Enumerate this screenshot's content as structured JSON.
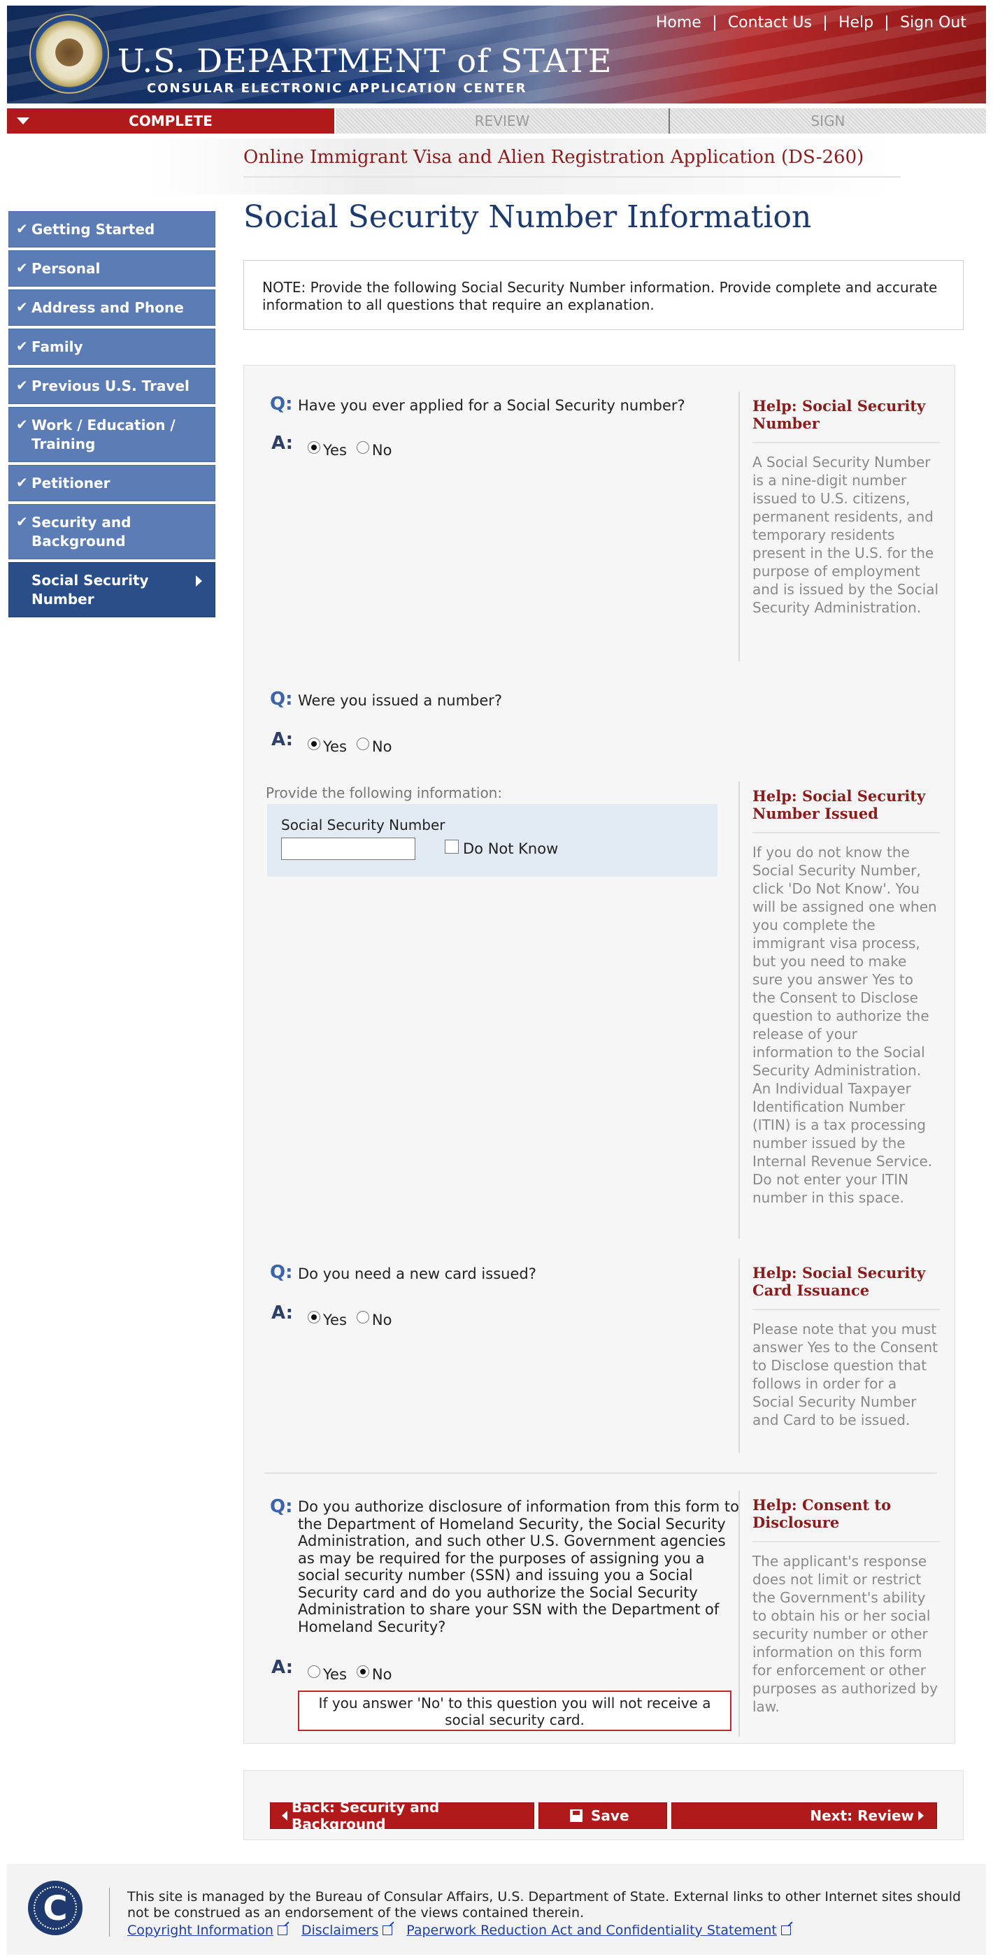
{
  "header": {
    "agency_name": "U.S. DEPARTMENT of STATE",
    "subtitle": "CONSULAR ELECTRONIC APPLICATION CENTER",
    "nav": [
      "Home",
      "Contact Us",
      "Help",
      "Sign Out"
    ]
  },
  "progress": {
    "steps": [
      "COMPLETE",
      "REVIEW",
      "SIGN"
    ],
    "active": "COMPLETE"
  },
  "form_title": "Online Immigrant Visa and Alien Registration Application (DS-260)",
  "sidebar": {
    "items": [
      {
        "label": "Getting Started",
        "complete": true
      },
      {
        "label": "Personal",
        "complete": true
      },
      {
        "label": "Address and Phone",
        "complete": true
      },
      {
        "label": "Family",
        "complete": true
      },
      {
        "label": "Previous U.S. Travel",
        "complete": true
      },
      {
        "label": "Work / Education / Training",
        "complete": true
      },
      {
        "label": "Petitioner",
        "complete": true
      },
      {
        "label": "Security and Background",
        "complete": true
      },
      {
        "label": "Social Security Number",
        "complete": false,
        "active": true
      }
    ]
  },
  "page_title": "Social Security Number Information",
  "note": "NOTE: Provide the following Social Security Number information. Provide complete and accurate information to all questions that require an explanation.",
  "labels": {
    "q": "Q:",
    "a": "A:",
    "help_prefix": "Help:"
  },
  "questions": [
    {
      "text": "Have you ever applied for a Social Security number?",
      "options": [
        "Yes",
        "No"
      ],
      "selected": "Yes",
      "help_title": "Social Security Number",
      "help_body": "A Social Security Number is a nine-digit number issued to U.S. citizens, permanent residents, and temporary residents present in the U.S. for the purpose of employment and is issued by the Social Security Administration."
    },
    {
      "text": "Were you issued a number?",
      "options": [
        "Yes",
        "No"
      ],
      "selected": "Yes",
      "help_title": "Social Security Number Issued",
      "help_body": "If you do not know the Social Security Number, click 'Do Not Know'. You will be assigned one when you complete the immigrant visa process, but you need to make sure you answer Yes to the Consent to Disclose question to authorize the release of your information to the Social Security Administration. An Individual Taxpayer Identification Number (ITIN) is a tax processing number issued by the Internal Revenue Service. Do not enter your ITIN number in this space."
    },
    {
      "text": "Do you need a new card issued?",
      "options": [
        "Yes",
        "No"
      ],
      "selected": "Yes",
      "help_title": "Social Security Card Issuance",
      "help_body": "Please note that you must answer Yes to the Consent to Disclose question that follows in order for a Social Security Number and Card to be issued."
    },
    {
      "text": "Do you authorize disclosure of information from this form to the Department of Homeland Security, the Social Security Administration, and such other U.S. Government agencies as may be required for the purposes of assigning you a social security number (SSN) and issuing you a Social Security card and do you authorize the Social Security Administration to share your SSN with the Department of Homeland Security?",
      "options": [
        "Yes",
        "No"
      ],
      "selected": "No",
      "help_title": "Consent to Disclosure",
      "help_body": "The applicant's response does not limit or restrict the Government's ability to obtain his or her social security number or other information on this form for enforcement or other purposes as authorized by law.",
      "warning": "If you answer 'No' to this question you will not receive a social security card."
    }
  ],
  "ssn_section": {
    "provide_label": "Provide the following information:",
    "field_label": "Social Security Number",
    "value": "",
    "do_not_know_label": "Do Not Know",
    "do_not_know_checked": false
  },
  "buttons": {
    "back": "Back: Security and Background",
    "save": "Save",
    "next": "Next: Review"
  },
  "footer": {
    "text": "This site is managed by the Bureau of Consular Affairs, U.S. Department of State. External links to other Internet sites should not be construed as an endorsement of the views contained therein.",
    "links": [
      "Copyright Information",
      "Disclaimers",
      "Paperwork Reduction Act and Confidentiality Statement"
    ]
  }
}
